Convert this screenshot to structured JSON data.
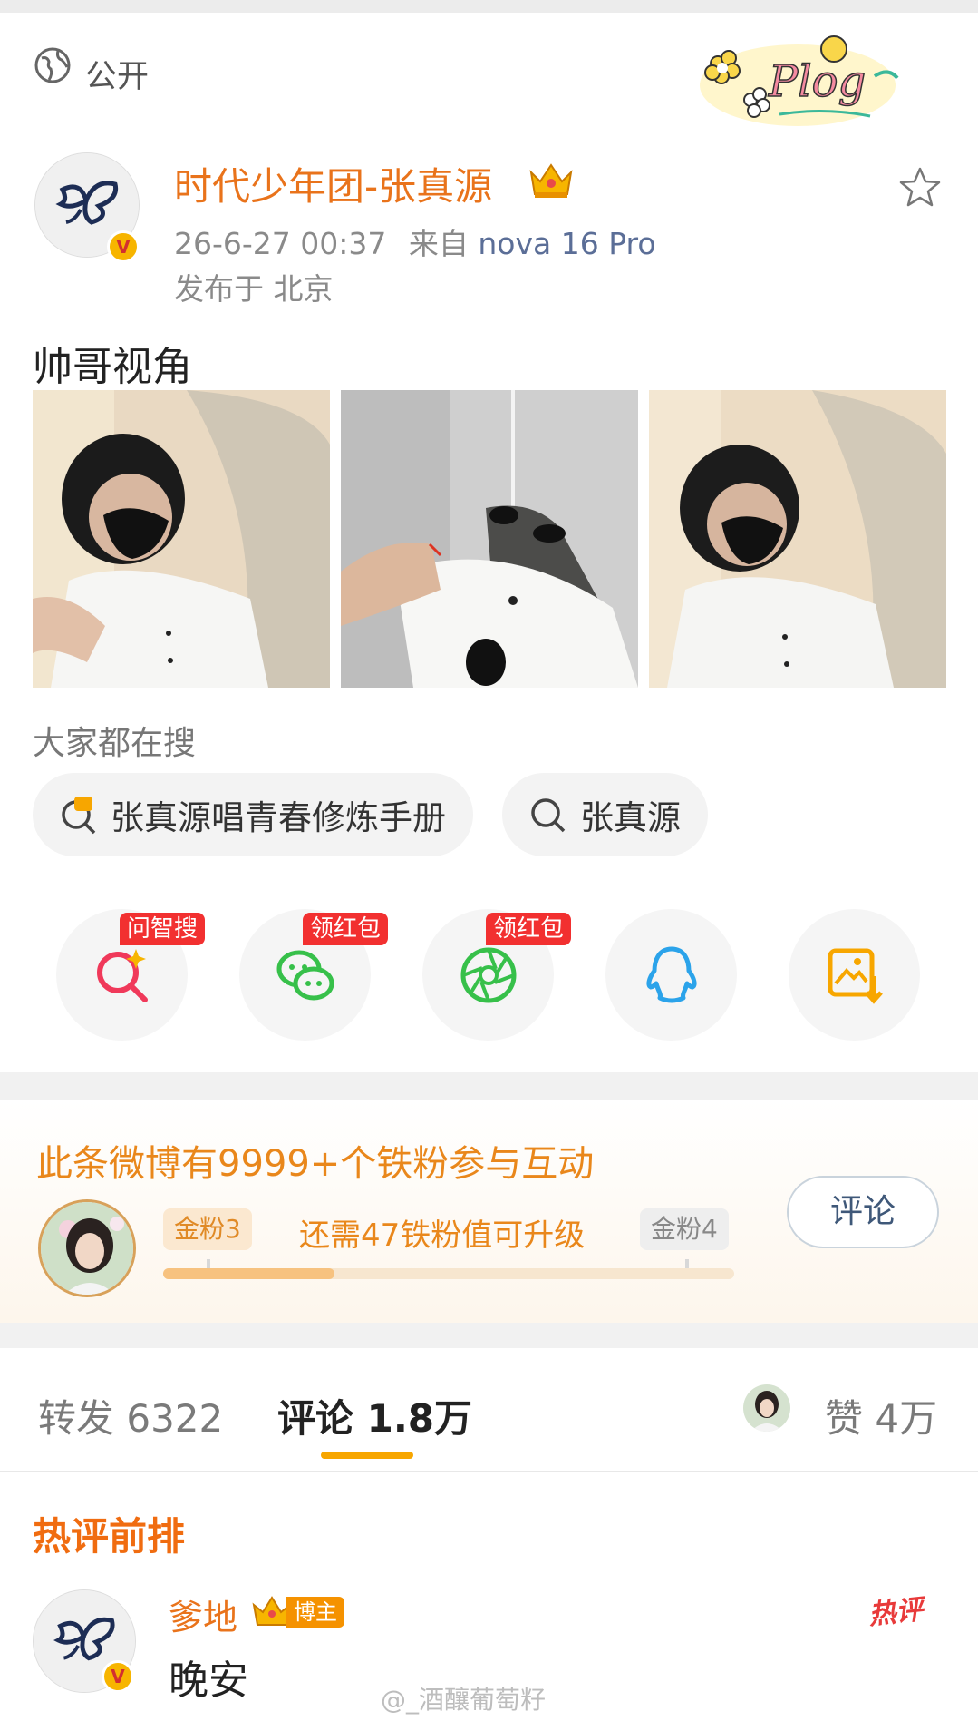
{
  "visibility": {
    "label": "公开"
  },
  "sticker": {
    "text": "Plog"
  },
  "post": {
    "author": "时代少年团-张真源",
    "time": "26-6-27 00:37",
    "source_prefix": "来自",
    "device": "nova 16 Pro",
    "location": "发布于 北京",
    "text": "帅哥视角"
  },
  "search": {
    "title": "大家都在搜",
    "chips": [
      "张真源唱青春修炼手册",
      "张真源"
    ]
  },
  "share": {
    "tags": [
      "问智搜",
      "领红包",
      "领红包"
    ],
    "icons": [
      "ai-search-icon",
      "wechat-icon",
      "moments-icon",
      "qq-icon",
      "save-image-icon"
    ]
  },
  "fan": {
    "title": "此条微博有9999+个铁粉参与互动",
    "level_current": "金粉3",
    "progress_text": "还需47铁粉值可升级",
    "level_next": "金粉4",
    "progress": 0.3,
    "button": "评论"
  },
  "tabs": {
    "repost": "转发 6322",
    "comments": "评论 1.8万",
    "likes": "赞 4万"
  },
  "comments": {
    "header": "热评前排",
    "first": {
      "name": "爹地",
      "badge": "博主",
      "text": "晚安",
      "stamp": "热评"
    }
  },
  "watermark": "@_酒釀葡萄籽",
  "colors": {
    "accent": "#e9731b",
    "tab_indicator": "#f7a600",
    "hot": "#f06c10"
  }
}
